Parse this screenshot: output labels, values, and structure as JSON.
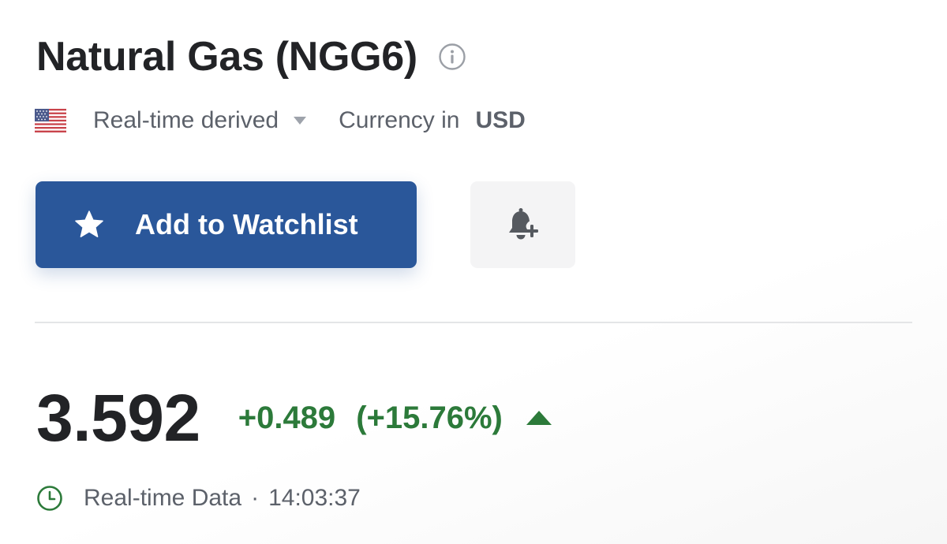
{
  "instrument": {
    "title": "Natural Gas (NGG6)"
  },
  "meta": {
    "flag_icon": "us-flag-icon",
    "source": "Real-time derived",
    "currency_label": "Currency in",
    "currency_value": "USD"
  },
  "actions": {
    "watchlist_label": "Add to Watchlist",
    "watchlist_icon": "star-icon",
    "alert_icon": "bell-plus-icon"
  },
  "quote": {
    "price": "3.592",
    "change": "+0.489",
    "change_percent": "(+15.76%)",
    "direction_icon": "triangle-up-icon"
  },
  "status": {
    "icon": "clock-icon",
    "label": "Real-time Data",
    "separator": "·",
    "time": "14:03:37"
  },
  "colors": {
    "brand_blue": "#2a579a",
    "positive_green": "#2c7a3a",
    "text_dark": "#222326",
    "text_muted": "#5c616a"
  }
}
